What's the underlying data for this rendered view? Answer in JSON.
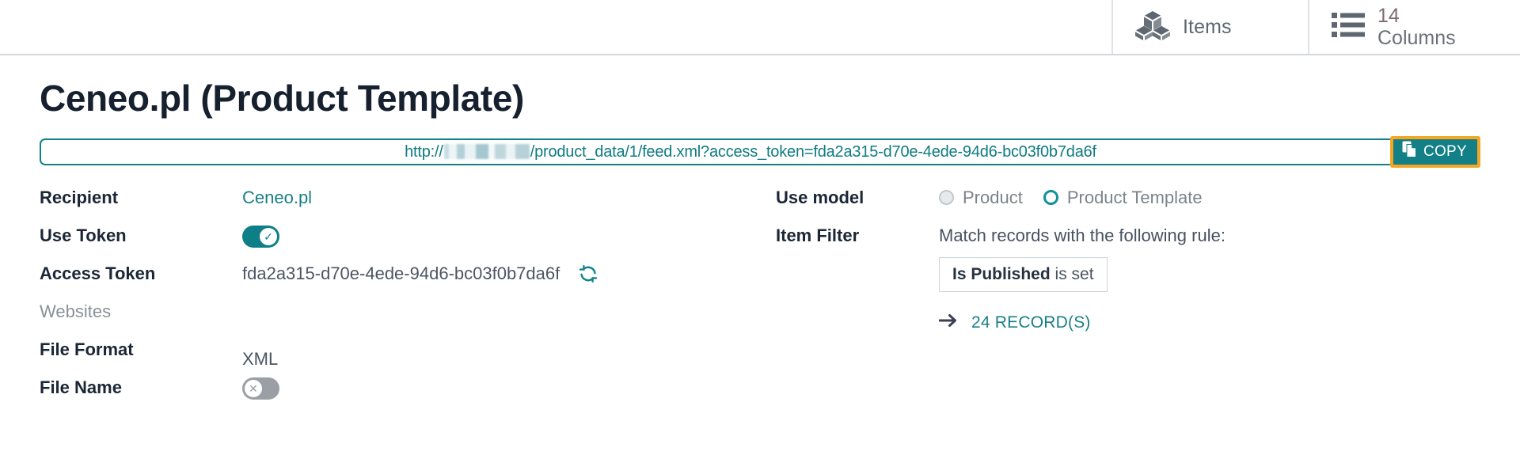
{
  "topbar": {
    "items_button": {
      "label": "Items",
      "icon": "cubes-icon"
    },
    "columns_button": {
      "count": "14",
      "label": "Columns",
      "icon": "list-icon"
    }
  },
  "page": {
    "title": "Ceneo.pl (Product Template)"
  },
  "url_bar": {
    "prefix": "http://",
    "host_redacted": true,
    "suffix": "/product_data/1/feed.xml?access_token=fda2a315-d70e-4ede-94d6-bc03f0b7da6f",
    "copy_button": {
      "label": "COPY",
      "icon": "copy-icon"
    },
    "border_color": "#137f87",
    "highlight_color": "#f5a623"
  },
  "left_fields": {
    "recipient": {
      "label": "Recipient",
      "value": "Ceneo.pl"
    },
    "use_token": {
      "label": "Use Token",
      "state": "on",
      "icon": "check-icon"
    },
    "access_token": {
      "label": "Access Token",
      "value": "fda2a315-d70e-4ede-94d6-bc03f0b7da6f",
      "refresh_icon": "refresh-icon"
    },
    "websites": {
      "label": "Websites",
      "value": ""
    },
    "file_format": {
      "label": "File Format",
      "value": "XML"
    },
    "file_name": {
      "label": "File Name",
      "state": "off",
      "icon": "close-icon"
    }
  },
  "right_fields": {
    "use_model": {
      "label": "Use model",
      "options": [
        {
          "label": "Product",
          "selected": false
        },
        {
          "label": "Product Template",
          "selected": true
        }
      ]
    },
    "item_filter": {
      "label": "Item Filter",
      "lead_text": "Match records with the following rule:",
      "rule": {
        "field": "Is Published",
        "condition": "is set"
      },
      "records_link": {
        "text": "24 RECORD(S)",
        "icon": "arrow-right-icon"
      }
    }
  },
  "colors": {
    "accent_teal": "#0e7f86",
    "highlight_orange": "#f5a623",
    "text_dark": "#1b2636",
    "text_muted": "#8a9097"
  }
}
